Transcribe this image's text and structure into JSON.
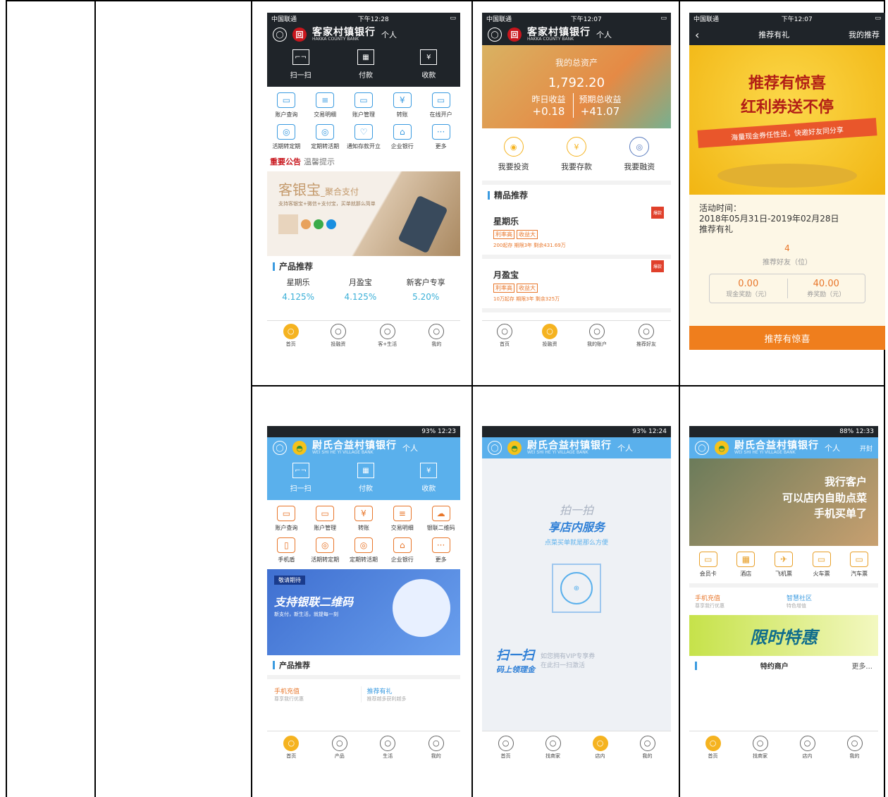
{
  "s1": {
    "carrier": "中国联通",
    "time": "下午12:28",
    "bank": "客家村镇银行",
    "bank_en": "HAKKA COUNTY BANK",
    "ge": "个人",
    "qa": [
      "扫一扫",
      "付款",
      "收款"
    ],
    "grid": [
      {
        "l": "账户查询",
        "i": "▭"
      },
      {
        "l": "交易明细",
        "i": "≡"
      },
      {
        "l": "账户管理",
        "i": "▭"
      },
      {
        "l": "转账",
        "i": "¥"
      },
      {
        "l": "在线开户",
        "i": "▭"
      },
      {
        "l": "活期转定期",
        "i": "◎"
      },
      {
        "l": "定期转活期",
        "i": "◎"
      },
      {
        "l": "通知存款开立",
        "i": "♡"
      },
      {
        "l": "企业银行",
        "i": "⌂"
      },
      {
        "l": "更多",
        "i": "···"
      }
    ],
    "notice": "重要公告",
    "notice2": "温馨提示",
    "banner_t": "客银宝",
    "banner_t2": "_聚合支付",
    "banner_s": "支持客银宝+微信+支付宝，买单就那么简单",
    "sec": "产品推荐",
    "prods": [
      {
        "n": "星期乐",
        "r": "4.125%"
      },
      {
        "n": "月盈宝",
        "r": "4.125%"
      },
      {
        "n": "新客户专享",
        "r": "5.20%"
      }
    ],
    "tabs": [
      "首页",
      "投融资",
      "客+生活",
      "我的"
    ]
  },
  "s2": {
    "carrier": "中国联通",
    "time": "下午12:07",
    "bank": "客家村镇银行",
    "bank_en": "HAKKA COUNTY BANK",
    "ge": "个人",
    "asset_l": "我的总资产",
    "asset": "1,792.20",
    "y_l": "昨日收益",
    "y": "+0.18",
    "e_l": "预期总收益",
    "e": "+41.07",
    "acts": [
      "我要投资",
      "我要存款",
      "我要融资"
    ],
    "sec": "精品推荐",
    "items": [
      {
        "n": "星期乐",
        "t1": "利率高",
        "t2": "收益大",
        "d": "200起存 期限3年 剩余431.69万"
      },
      {
        "n": "月盈宝",
        "t1": "利率高",
        "t2": "收益大",
        "d": "10万起存 期限3年 剩余325万"
      }
    ],
    "badge": "爆款",
    "tabs": [
      "首页",
      "投融资",
      "我的账户",
      "推荐好友"
    ]
  },
  "s3": {
    "carrier": "中国联通",
    "time": "下午12:07",
    "title": "推荐有礼",
    "right": "我的推荐",
    "h1": "推荐有惊喜",
    "h2": "红利券送不停",
    "ribbon": "海量现金券任性送，快邀好友同分享",
    "time_l": "活动时间：",
    "range": "2018年05月31日-2019年02月28日",
    "name": "推荐有礼",
    "cnt": "4",
    "cnt_l": "推荐好友（位）",
    "cash": "0.00",
    "cash_l": "现金奖励（元）",
    "coup": "40.00",
    "coup_l": "券奖励（元）",
    "btn": "推荐有惊喜"
  },
  "s4": {
    "status": "93%  12:23",
    "bank": "尉氏合益村镇银行",
    "bank_en": "WEI SHI HE YI VILLAGE BANK",
    "ge": "个人",
    "qa": [
      "扫一扫",
      "付款",
      "收款"
    ],
    "grid": [
      {
        "l": "账户查询",
        "i": "▭"
      },
      {
        "l": "账户管理",
        "i": "▭"
      },
      {
        "l": "转账",
        "i": "¥"
      },
      {
        "l": "交易明细",
        "i": "≡"
      },
      {
        "l": "银联二维码",
        "i": "☁"
      },
      {
        "l": "手机盾",
        "i": "▯"
      },
      {
        "l": "活期转定期",
        "i": "◎"
      },
      {
        "l": "定期转活期",
        "i": "◎"
      },
      {
        "l": "企业银行",
        "i": "⌂"
      },
      {
        "l": "更多",
        "i": "···"
      }
    ],
    "banner_tag": "敬请期待",
    "banner_t": "支持银联二维码",
    "banner_s": "新支付，新生活，就提每一刻",
    "sec": "产品推荐",
    "p1": "手机充值",
    "p1s": "尊享我行优惠",
    "p2": "推荐有礼",
    "p2s": "推荐越多获利越多",
    "tabs": [
      "首页",
      "产品",
      "生活",
      "我的"
    ]
  },
  "s5": {
    "status": "93%  12:24",
    "bank": "尉氏合益村镇银行",
    "bank_en": "WEI SHI HE YI VILLAGE BANK",
    "ge": "个人",
    "t1": "拍一拍",
    "t2": "享店内服务",
    "t3": "点菜买单就是那么方便",
    "s1": "扫一扫",
    "s2": "码上领理金",
    "s3": "如您拥有VIP专享券",
    "s4": "在此扫一扫激活",
    "tabs": [
      "首页",
      "找商家",
      "店内",
      "我的"
    ]
  },
  "s6": {
    "status": "88%  12:33",
    "bank": "尉氏合益村镇银行",
    "bank_en": "WEI SHI HE YI VILLAGE BANK",
    "ge": "个人",
    "right": "开封",
    "ban1": "我行客户",
    "ban2": "可以店内自助点菜",
    "ban3": "手机买单了",
    "cats": [
      {
        "l": "会员卡",
        "i": "▭"
      },
      {
        "l": "酒店",
        "i": "▦"
      },
      {
        "l": "飞机票",
        "i": "✈"
      },
      {
        "l": "火车票",
        "i": "▭"
      },
      {
        "l": "汽车票",
        "i": "▭"
      }
    ],
    "c1": "手机充值",
    "c1s": "尊享我行优惠",
    "c2": "智慧社区",
    "c2s": "特色增值",
    "promo": "限时特惠",
    "sec": "特约商户",
    "more": "更多...",
    "tabs": [
      "首页",
      "找商家",
      "店内",
      "我的"
    ]
  }
}
